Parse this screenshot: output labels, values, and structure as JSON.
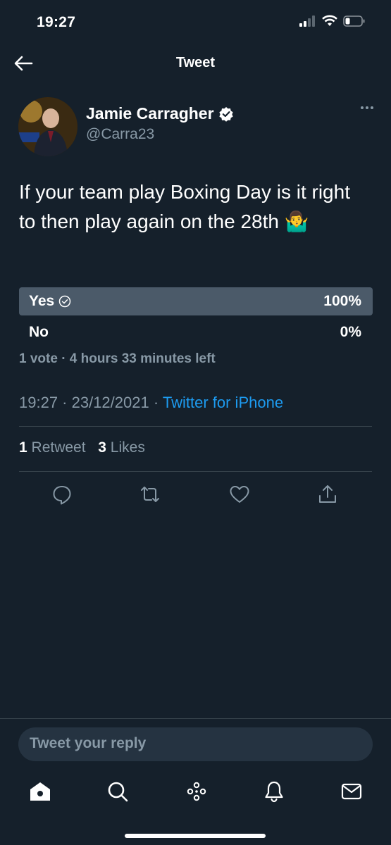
{
  "status_bar": {
    "time": "19:27"
  },
  "header": {
    "title": "Tweet"
  },
  "author": {
    "name": "Jamie Carragher",
    "handle": "@Carra23"
  },
  "tweet": {
    "text": "If your team play Boxing Day is it right to then play again on the 28th 🤷‍♂️"
  },
  "poll": {
    "options": [
      {
        "label": "Yes",
        "percent": "100%",
        "winner": true
      },
      {
        "label": "No",
        "percent": "0%",
        "winner": false
      }
    ],
    "meta": "1 vote · 4 hours 33 minutes left"
  },
  "timestamp": {
    "time_date": "19:27 · 23/12/2021 · ",
    "source": "Twitter for iPhone"
  },
  "stats": {
    "retweets_count": "1",
    "retweets_label": "Retweet",
    "likes_count": "3",
    "likes_label": "Likes"
  },
  "reply": {
    "placeholder": "Tweet your reply"
  },
  "colors": {
    "background": "#15202b",
    "accent": "#1d9bf0",
    "muted": "#8899a6",
    "poll_bar": "#4b5a69"
  },
  "icons": [
    "back-arrow-icon",
    "verified-badge-icon",
    "more-icon",
    "reply-icon",
    "retweet-icon",
    "like-icon",
    "share-icon",
    "home-icon",
    "search-icon",
    "spaces-icon",
    "notifications-icon",
    "messages-icon"
  ]
}
